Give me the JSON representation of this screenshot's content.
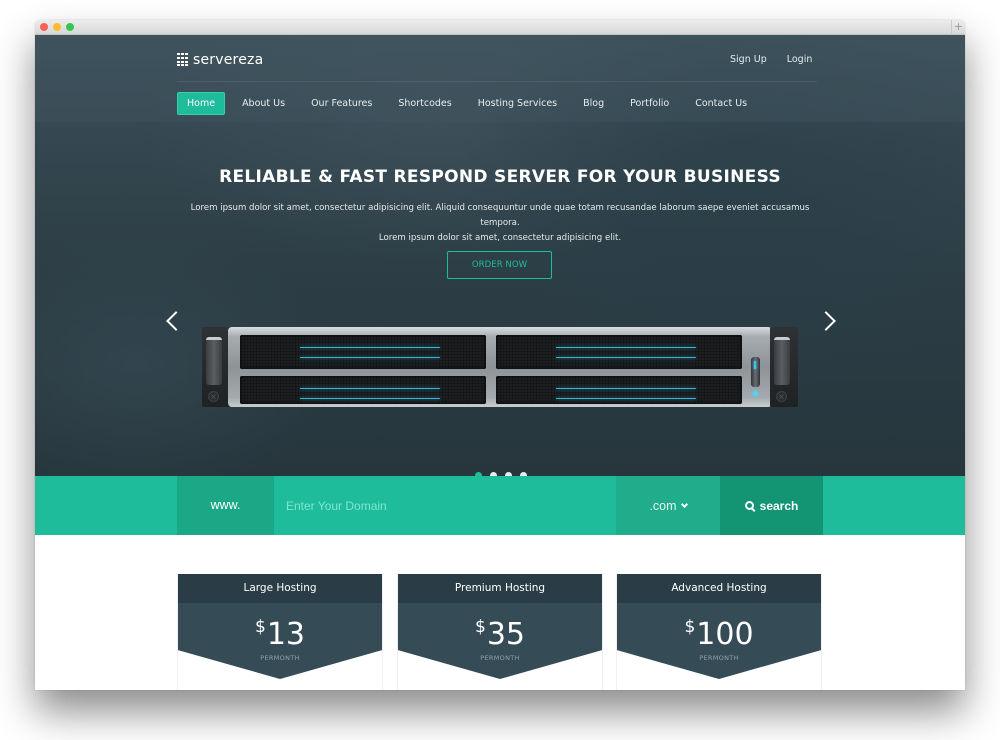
{
  "browser": {
    "new_tab_label": "+"
  },
  "header": {
    "brand": "servereza",
    "top_links": [
      {
        "label": "Sign Up"
      },
      {
        "label": "Login"
      }
    ],
    "nav": [
      {
        "label": "Home",
        "active": true
      },
      {
        "label": "About Us"
      },
      {
        "label": "Our Features"
      },
      {
        "label": "Shortcodes"
      },
      {
        "label": "Hosting Services"
      },
      {
        "label": "Blog"
      },
      {
        "label": "Portfolio"
      },
      {
        "label": "Contact Us"
      }
    ]
  },
  "hero": {
    "title": "RELIABLE & FAST RESPOND SERVER FOR YOUR BUSINESS",
    "description_line1": "Lorem ipsum dolor sit amet, consectetur adipisicing elit. Aliquid consequuntur unde quae totam recusandae laborum saepe eveniet accusamus tempora.",
    "description_line2": "Lorem ipsum dolor sit amet, consectetur adipisicing elit.",
    "cta_label": "ORDER NOW",
    "prev_icon": "chevron-left-icon",
    "next_icon": "chevron-right-icon",
    "slides_total": 4,
    "active_slide": 1
  },
  "domain_search": {
    "prefix": "www.",
    "input_value": "",
    "input_placeholder": "Enter Your Domain",
    "tld_selected": ".com",
    "search_label": "search",
    "search_icon": "search-icon"
  },
  "pricing": {
    "plans": [
      {
        "name": "Large Hosting",
        "currency": "$",
        "price": "13",
        "period": "PERMONTH"
      },
      {
        "name": "Premium Hosting",
        "currency": "$",
        "price": "35",
        "period": "PERMONTH"
      },
      {
        "name": "Advanced Hosting",
        "currency": "$",
        "price": "100",
        "period": "PERMONTH"
      }
    ]
  },
  "colors": {
    "accent": "#1ebc9b",
    "accent_dark": "#139473",
    "hero_bg": "#34464f",
    "plan_head": "#2a3c46",
    "plan_body": "#354b56"
  }
}
